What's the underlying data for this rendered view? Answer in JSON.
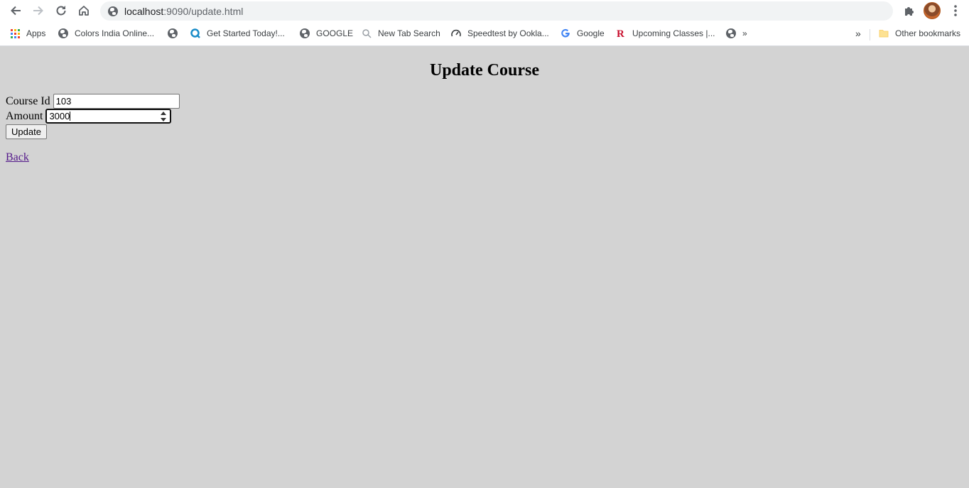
{
  "browser": {
    "url_host": "localhost",
    "url_rest": ":9090/update.html",
    "bookmarks": [
      {
        "label": "Apps",
        "icon": "apps-grid-icon"
      },
      {
        "label": "Colors India Online...",
        "icon": "globe-icon"
      },
      {
        "label": "",
        "icon": "globe-icon"
      },
      {
        "label": "Get Started Today!...",
        "icon": "q-logo-icon"
      },
      {
        "label": "GOOGLE",
        "icon": "globe-icon"
      },
      {
        "label": "New Tab Search",
        "icon": "search-icon"
      },
      {
        "label": "Speedtest by Ookla...",
        "icon": "speedometer-icon"
      },
      {
        "label": "Google",
        "icon": "google-g-icon"
      },
      {
        "label": "Upcoming Classes |...",
        "icon": "r-logo-icon"
      },
      {
        "label": "»",
        "icon": "globe-icon"
      }
    ],
    "other_bookmarks": "Other bookmarks",
    "overflow": "»"
  },
  "page": {
    "title": "Update Course",
    "course_id_label": "Course Id",
    "course_id_value": "103",
    "amount_label": "Amount",
    "amount_value": "3000",
    "update_button": "Update",
    "back_link": "Back"
  },
  "colors": {
    "page_background": "#d3d3d3",
    "link_visited": "#551a8b",
    "omnibox_bg": "#f1f3f4"
  }
}
